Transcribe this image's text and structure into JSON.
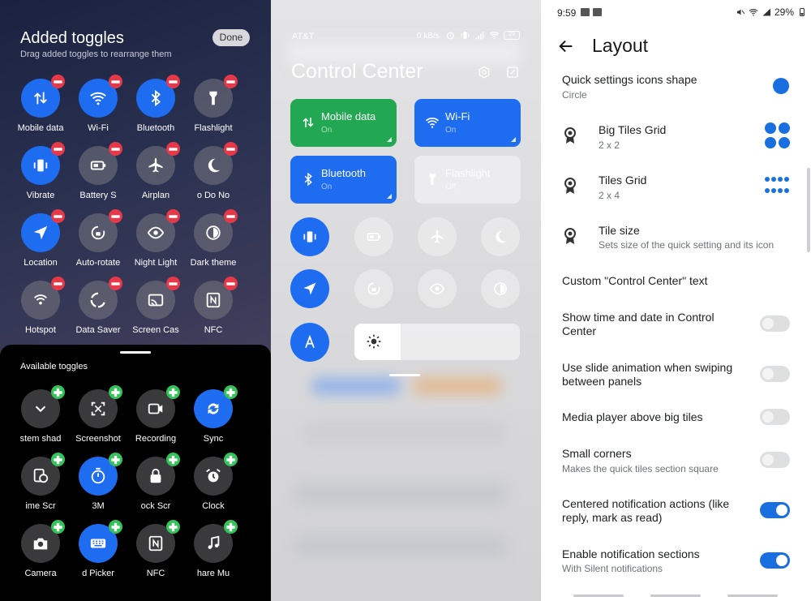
{
  "panel1": {
    "title": "Added toggles",
    "subtitle": "Drag added toggles to rearrange them",
    "done_label": "Done",
    "added": [
      {
        "label": "Mobile data",
        "icon": "mobile-data-icon",
        "on": true
      },
      {
        "label": "Wi-Fi",
        "icon": "wifi-icon",
        "on": true
      },
      {
        "label": "Bluetooth",
        "icon": "bluetooth-icon",
        "on": true
      },
      {
        "label": "Flashlight",
        "icon": "flashlight-icon",
        "on": false
      },
      {
        "label": "Vibrate",
        "icon": "vibrate-icon",
        "on": true
      },
      {
        "label": "Battery S",
        "icon": "battery-icon",
        "on": false
      },
      {
        "label": "Airplan",
        "icon": "airplane-icon",
        "on": false
      },
      {
        "label": "o  Do No",
        "icon": "moon-icon",
        "on": false
      },
      {
        "label": "Location",
        "icon": "location-icon",
        "on": true
      },
      {
        "label": "Auto-rotate",
        "icon": "rotate-icon",
        "on": false
      },
      {
        "label": "Night Light",
        "icon": "eye-icon",
        "on": false
      },
      {
        "label": "Dark theme",
        "icon": "contrast-icon",
        "on": false
      },
      {
        "label": "Hotspot",
        "icon": "hotspot-icon",
        "on": false
      },
      {
        "label": "Data Saver",
        "icon": "data-saver-icon",
        "on": false
      },
      {
        "label": "Screen Cas",
        "icon": "cast-icon",
        "on": false
      },
      {
        "label": "NFC",
        "icon": "nfc-icon",
        "on": false
      }
    ],
    "available_label": "Available toggles",
    "available": [
      {
        "label": "stem shad",
        "icon": "chevron-down-icon",
        "on": false
      },
      {
        "label": "Screenshot",
        "icon": "screenshot-icon",
        "on": false
      },
      {
        "label": "Recording",
        "icon": "video-icon",
        "on": false
      },
      {
        "label": "Sync",
        "icon": "sync-icon",
        "on": true
      },
      {
        "label": "ime    Scr",
        "icon": "screen-time-icon",
        "on": false
      },
      {
        "label": "3M",
        "icon": "timer-icon",
        "on": true
      },
      {
        "label": "ock    Scr",
        "icon": "lock-icon",
        "on": false
      },
      {
        "label": "Clock",
        "icon": "alarm-icon",
        "on": false
      },
      {
        "label": "Camera",
        "icon": "camera-icon",
        "on": false
      },
      {
        "label": "d Picker",
        "icon": "keyboard-icon",
        "on": true
      },
      {
        "label": "NFC",
        "icon": "nfc-icon",
        "on": false
      },
      {
        "label": "hare    Mu",
        "icon": "music-icon",
        "on": false
      }
    ]
  },
  "panel2": {
    "carrier": "AT&T",
    "netspeed": "0 kB/s",
    "battery": "29",
    "title": "Control Center",
    "big_tiles": [
      {
        "name": "Mobile data",
        "state": "On",
        "color": "#22a852",
        "icon": "mobile-data-icon"
      },
      {
        "name": "Wi-Fi",
        "state": "On",
        "color": "#1e6cf0",
        "icon": "wifi-icon"
      },
      {
        "name": "Bluetooth",
        "state": "On",
        "color": "#1e6cf0",
        "icon": "bluetooth-icon"
      },
      {
        "name": "Flashlight",
        "state": "Off",
        "color": "#ececee",
        "icon": "flashlight-icon"
      }
    ],
    "brightness": 0.28
  },
  "panel3": {
    "time": "9:59",
    "battery": "29%",
    "title": "Layout",
    "rows": [
      {
        "title": "Quick settings icons shape",
        "sub": "Circle"
      },
      {
        "title": "Big Tiles Grid",
        "sub": "2 x 2"
      },
      {
        "title": "Tiles Grid",
        "sub": "2 x 4"
      },
      {
        "title": "Tile size",
        "sub": "Sets size of the quick setting and its icon"
      },
      {
        "title": "Custom \"Control Center\" text"
      },
      {
        "title": "Show time and date in Control Center",
        "toggle": false
      },
      {
        "title": "Use slide animation when swiping between panels",
        "toggle": false
      },
      {
        "title": "Media player above big tiles",
        "toggle": false
      },
      {
        "title": "Small corners",
        "sub": "Makes the quick tiles section square",
        "toggle": false
      },
      {
        "title": "Centered notification actions (like reply, mark as read)",
        "toggle": true
      },
      {
        "title": "Enable notification sections",
        "sub": "With Silent notifications",
        "toggle": true
      }
    ]
  }
}
